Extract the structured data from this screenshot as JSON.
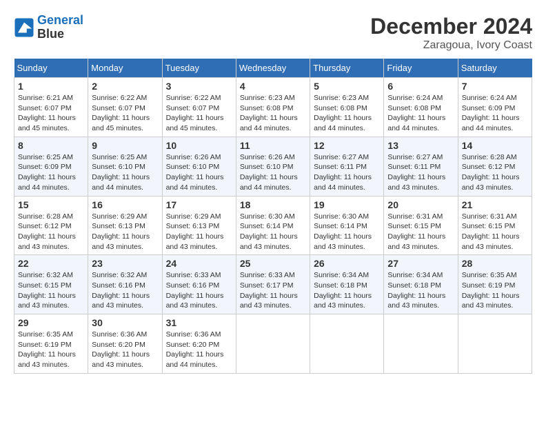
{
  "header": {
    "logo_line1": "General",
    "logo_line2": "Blue",
    "month": "December 2024",
    "location": "Zaragoua, Ivory Coast"
  },
  "weekdays": [
    "Sunday",
    "Monday",
    "Tuesday",
    "Wednesday",
    "Thursday",
    "Friday",
    "Saturday"
  ],
  "weeks": [
    [
      {
        "day": 1,
        "rise": "6:21 AM",
        "set": "6:07 PM",
        "daylight": "11 hours and 45 minutes."
      },
      {
        "day": 2,
        "rise": "6:22 AM",
        "set": "6:07 PM",
        "daylight": "11 hours and 45 minutes."
      },
      {
        "day": 3,
        "rise": "6:22 AM",
        "set": "6:07 PM",
        "daylight": "11 hours and 45 minutes."
      },
      {
        "day": 4,
        "rise": "6:23 AM",
        "set": "6:08 PM",
        "daylight": "11 hours and 44 minutes."
      },
      {
        "day": 5,
        "rise": "6:23 AM",
        "set": "6:08 PM",
        "daylight": "11 hours and 44 minutes."
      },
      {
        "day": 6,
        "rise": "6:24 AM",
        "set": "6:08 PM",
        "daylight": "11 hours and 44 minutes."
      },
      {
        "day": 7,
        "rise": "6:24 AM",
        "set": "6:09 PM",
        "daylight": "11 hours and 44 minutes."
      }
    ],
    [
      {
        "day": 8,
        "rise": "6:25 AM",
        "set": "6:09 PM",
        "daylight": "11 hours and 44 minutes."
      },
      {
        "day": 9,
        "rise": "6:25 AM",
        "set": "6:10 PM",
        "daylight": "11 hours and 44 minutes."
      },
      {
        "day": 10,
        "rise": "6:26 AM",
        "set": "6:10 PM",
        "daylight": "11 hours and 44 minutes."
      },
      {
        "day": 11,
        "rise": "6:26 AM",
        "set": "6:10 PM",
        "daylight": "11 hours and 44 minutes."
      },
      {
        "day": 12,
        "rise": "6:27 AM",
        "set": "6:11 PM",
        "daylight": "11 hours and 44 minutes."
      },
      {
        "day": 13,
        "rise": "6:27 AM",
        "set": "6:11 PM",
        "daylight": "11 hours and 43 minutes."
      },
      {
        "day": 14,
        "rise": "6:28 AM",
        "set": "6:12 PM",
        "daylight": "11 hours and 43 minutes."
      }
    ],
    [
      {
        "day": 15,
        "rise": "6:28 AM",
        "set": "6:12 PM",
        "daylight": "11 hours and 43 minutes."
      },
      {
        "day": 16,
        "rise": "6:29 AM",
        "set": "6:13 PM",
        "daylight": "11 hours and 43 minutes."
      },
      {
        "day": 17,
        "rise": "6:29 AM",
        "set": "6:13 PM",
        "daylight": "11 hours and 43 minutes."
      },
      {
        "day": 18,
        "rise": "6:30 AM",
        "set": "6:14 PM",
        "daylight": "11 hours and 43 minutes."
      },
      {
        "day": 19,
        "rise": "6:30 AM",
        "set": "6:14 PM",
        "daylight": "11 hours and 43 minutes."
      },
      {
        "day": 20,
        "rise": "6:31 AM",
        "set": "6:15 PM",
        "daylight": "11 hours and 43 minutes."
      },
      {
        "day": 21,
        "rise": "6:31 AM",
        "set": "6:15 PM",
        "daylight": "11 hours and 43 minutes."
      }
    ],
    [
      {
        "day": 22,
        "rise": "6:32 AM",
        "set": "6:15 PM",
        "daylight": "11 hours and 43 minutes."
      },
      {
        "day": 23,
        "rise": "6:32 AM",
        "set": "6:16 PM",
        "daylight": "11 hours and 43 minutes."
      },
      {
        "day": 24,
        "rise": "6:33 AM",
        "set": "6:16 PM",
        "daylight": "11 hours and 43 minutes."
      },
      {
        "day": 25,
        "rise": "6:33 AM",
        "set": "6:17 PM",
        "daylight": "11 hours and 43 minutes."
      },
      {
        "day": 26,
        "rise": "6:34 AM",
        "set": "6:18 PM",
        "daylight": "11 hours and 43 minutes."
      },
      {
        "day": 27,
        "rise": "6:34 AM",
        "set": "6:18 PM",
        "daylight": "11 hours and 43 minutes."
      },
      {
        "day": 28,
        "rise": "6:35 AM",
        "set": "6:19 PM",
        "daylight": "11 hours and 43 minutes."
      }
    ],
    [
      {
        "day": 29,
        "rise": "6:35 AM",
        "set": "6:19 PM",
        "daylight": "11 hours and 43 minutes."
      },
      {
        "day": 30,
        "rise": "6:36 AM",
        "set": "6:20 PM",
        "daylight": "11 hours and 43 minutes."
      },
      {
        "day": 31,
        "rise": "6:36 AM",
        "set": "6:20 PM",
        "daylight": "11 hours and 44 minutes."
      },
      null,
      null,
      null,
      null
    ]
  ]
}
